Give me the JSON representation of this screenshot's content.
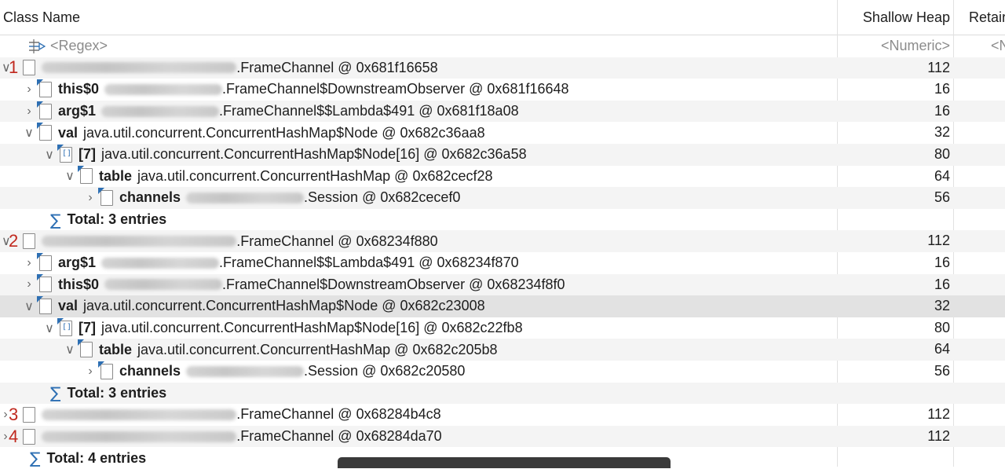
{
  "columns": {
    "class_name": "Class Name",
    "shallow_heap": "Shallow Heap",
    "retained": "Retair"
  },
  "filter": {
    "class_name": "<Regex>",
    "shallow_heap": "<Numeric>",
    "retained": "<N"
  },
  "rows": [
    {
      "marker": "1",
      "indent": 0,
      "expand": "open",
      "icon": "doc",
      "field": "",
      "blur": true,
      "name": ".FrameChannel @ 0x681f16658",
      "shallow": "112",
      "alt": true
    },
    {
      "marker": "",
      "indent": 1,
      "expand": "closed",
      "icon": "ref",
      "field": "this$0",
      "blur": true,
      "name": ".FrameChannel$DownstreamObserver @ 0x681f16648",
      "shallow": "16"
    },
    {
      "marker": "",
      "indent": 1,
      "expand": "closed",
      "icon": "ref",
      "field": "arg$1",
      "blur": true,
      "name": ".FrameChannel$$Lambda$491 @ 0x681f18a08",
      "shallow": "16",
      "alt": true
    },
    {
      "marker": "",
      "indent": 1,
      "expand": "open",
      "icon": "ref",
      "field": "val",
      "blur": false,
      "name": "java.util.concurrent.ConcurrentHashMap$Node @ 0x682c36aa8",
      "shallow": "32"
    },
    {
      "marker": "",
      "indent": 2,
      "expand": "open",
      "icon": "arr",
      "field": "[7]",
      "blur": false,
      "name": "java.util.concurrent.ConcurrentHashMap$Node[16] @ 0x682c36a58",
      "shallow": "80",
      "alt": true
    },
    {
      "marker": "",
      "indent": 3,
      "expand": "open",
      "icon": "ref",
      "field": "table",
      "blur": false,
      "name": "java.util.concurrent.ConcurrentHashMap @ 0x682cecf28",
      "shallow": "64"
    },
    {
      "marker": "",
      "indent": 4,
      "expand": "closed",
      "icon": "ref",
      "field": "channels",
      "blur": true,
      "name": ".Session @ 0x682cecef0",
      "shallow": "56",
      "alt": true
    },
    {
      "marker": "",
      "indent": 2,
      "expand": "none",
      "icon": "sigma",
      "field": "Total: 3 entries",
      "blur": false,
      "name": "",
      "shallow": ""
    },
    {
      "marker": "2",
      "indent": 0,
      "expand": "open",
      "icon": "doc",
      "field": "",
      "blur": true,
      "name": ".FrameChannel @ 0x68234f880",
      "shallow": "112",
      "alt": true
    },
    {
      "marker": "",
      "indent": 1,
      "expand": "closed",
      "icon": "ref",
      "field": "arg$1",
      "blur": true,
      "name": ".FrameChannel$$Lambda$491 @ 0x68234f870",
      "shallow": "16"
    },
    {
      "marker": "",
      "indent": 1,
      "expand": "closed",
      "icon": "ref",
      "field": "this$0",
      "blur": true,
      "name": ".FrameChannel$DownstreamObserver @ 0x68234f8f0",
      "shallow": "16",
      "alt": true
    },
    {
      "marker": "",
      "indent": 1,
      "expand": "open",
      "icon": "ref",
      "field": "val",
      "blur": false,
      "name": "java.util.concurrent.ConcurrentHashMap$Node @ 0x682c23008",
      "shallow": "32",
      "selected": true
    },
    {
      "marker": "",
      "indent": 2,
      "expand": "open",
      "icon": "arr",
      "field": "[7]",
      "blur": false,
      "name": "java.util.concurrent.ConcurrentHashMap$Node[16] @ 0x682c22fb8",
      "shallow": "80"
    },
    {
      "marker": "",
      "indent": 3,
      "expand": "open",
      "icon": "ref",
      "field": "table",
      "blur": false,
      "name": "java.util.concurrent.ConcurrentHashMap @ 0x682c205b8",
      "shallow": "64",
      "alt": true
    },
    {
      "marker": "",
      "indent": 4,
      "expand": "closed",
      "icon": "ref",
      "field": "channels",
      "blur": true,
      "name": ".Session @ 0x682c20580",
      "shallow": "56"
    },
    {
      "marker": "",
      "indent": 2,
      "expand": "none",
      "icon": "sigma",
      "field": "Total: 3 entries",
      "blur": false,
      "name": "",
      "shallow": "",
      "alt": true
    },
    {
      "marker": "3",
      "indent": 0,
      "expand": "closed",
      "icon": "doc",
      "field": "",
      "blur": true,
      "name": ".FrameChannel @ 0x68284b4c8",
      "shallow": "112"
    },
    {
      "marker": "4",
      "indent": 0,
      "expand": "closed",
      "icon": "doc",
      "field": "",
      "blur": true,
      "name": ".FrameChannel @ 0x68284da70",
      "shallow": "112",
      "alt": true
    },
    {
      "marker": "",
      "indent": 1,
      "expand": "none",
      "icon": "sigma",
      "field": "Total: 4 entries",
      "blur": false,
      "name": "",
      "shallow": ""
    }
  ]
}
